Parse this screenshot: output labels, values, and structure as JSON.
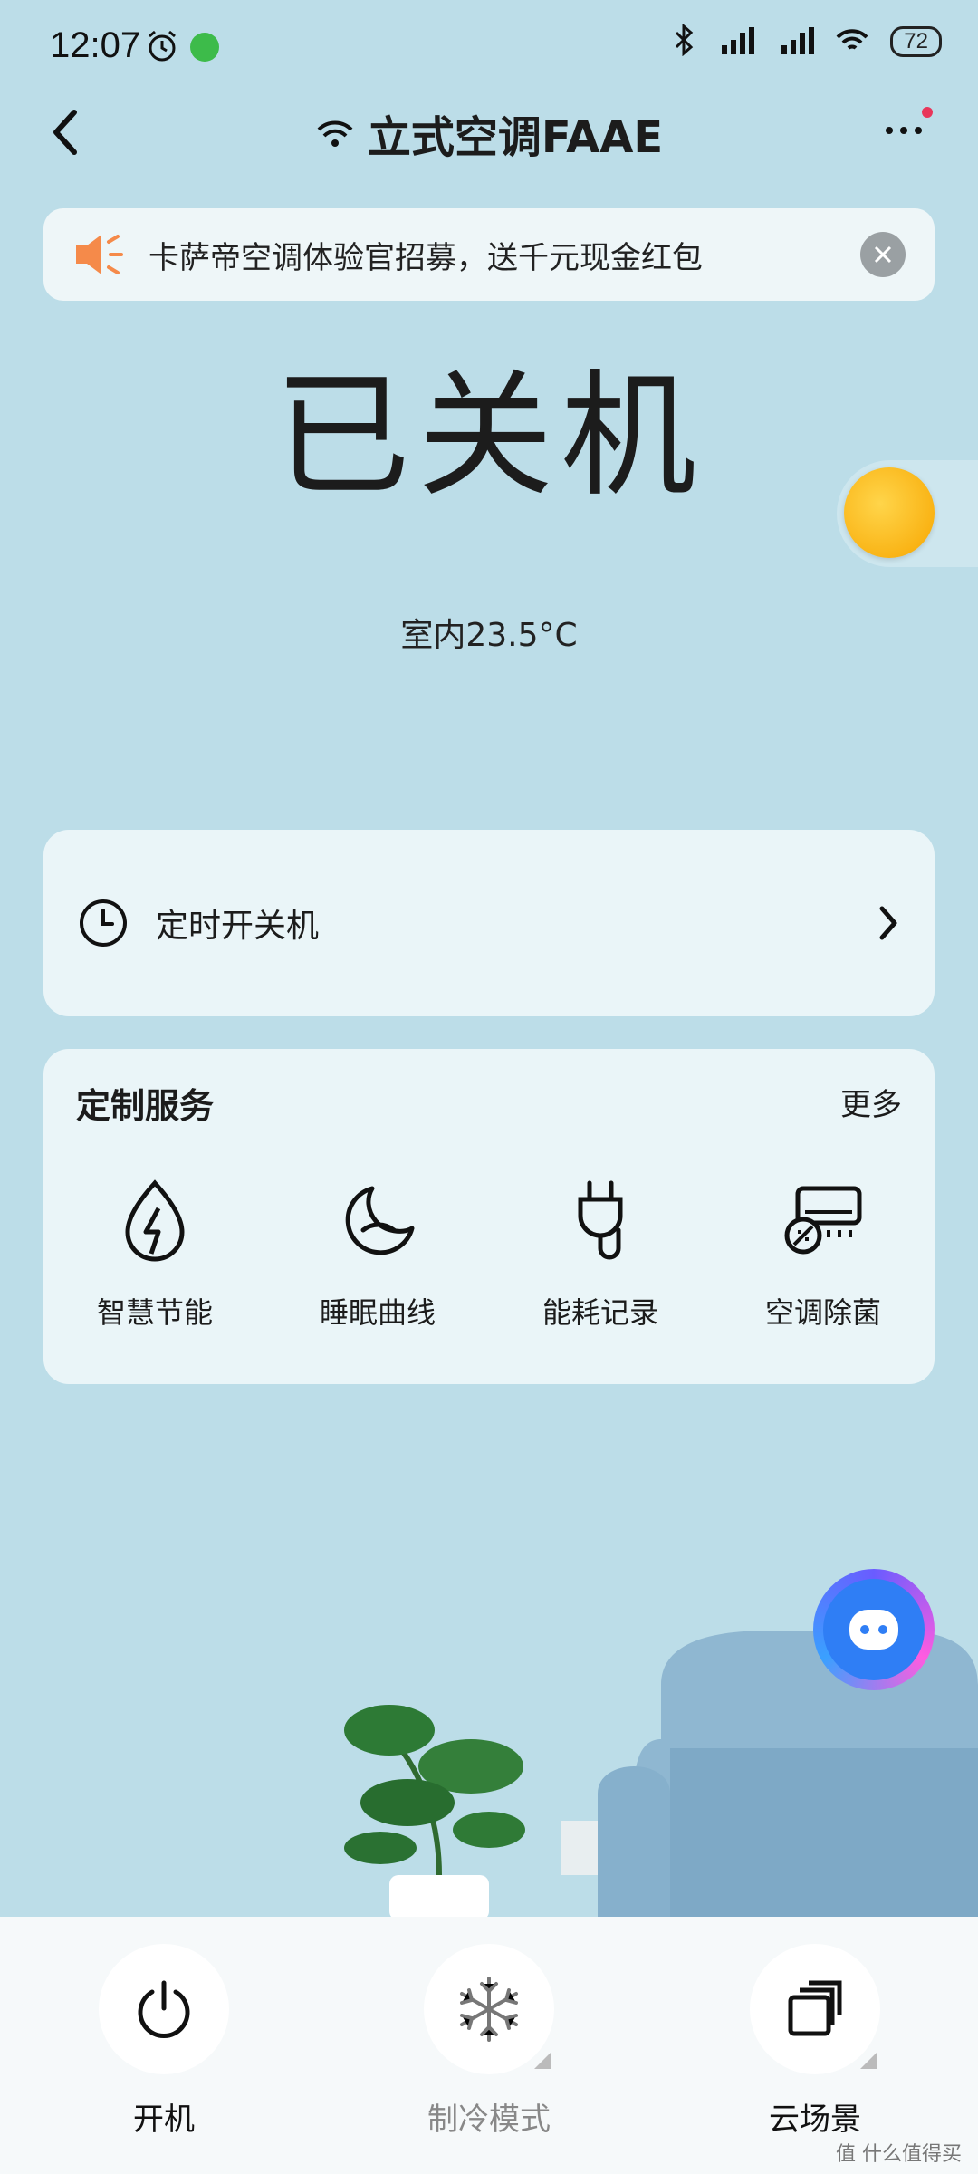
{
  "status_bar": {
    "time": "12:07",
    "battery": "72"
  },
  "header": {
    "title": "立式空调FAAE"
  },
  "notice": {
    "text": "卡萨帝空调体验官招募，送千元现金红包"
  },
  "device": {
    "state": "已关机",
    "indoor_temp": "室内23.5°C"
  },
  "timer": {
    "label": "定时开关机"
  },
  "services": {
    "title": "定制服务",
    "more": "更多",
    "items": [
      {
        "label": "智慧节能",
        "icon": "leaf-bolt-icon"
      },
      {
        "label": "睡眠曲线",
        "icon": "moon-icon"
      },
      {
        "label": "能耗记录",
        "icon": "plug-icon"
      },
      {
        "label": "空调除菌",
        "icon": "ac-sterilize-icon"
      }
    ]
  },
  "bottom_actions": [
    {
      "label": "开机",
      "icon": "power-icon"
    },
    {
      "label": "制冷模式",
      "icon": "snowflake-icon"
    },
    {
      "label": "云场景",
      "icon": "scenes-icon"
    }
  ],
  "watermark": "值 什么值得买",
  "colors": {
    "background": "#bcdde8",
    "card": "#eaf5f8",
    "accent_orange": "#f7a600"
  }
}
